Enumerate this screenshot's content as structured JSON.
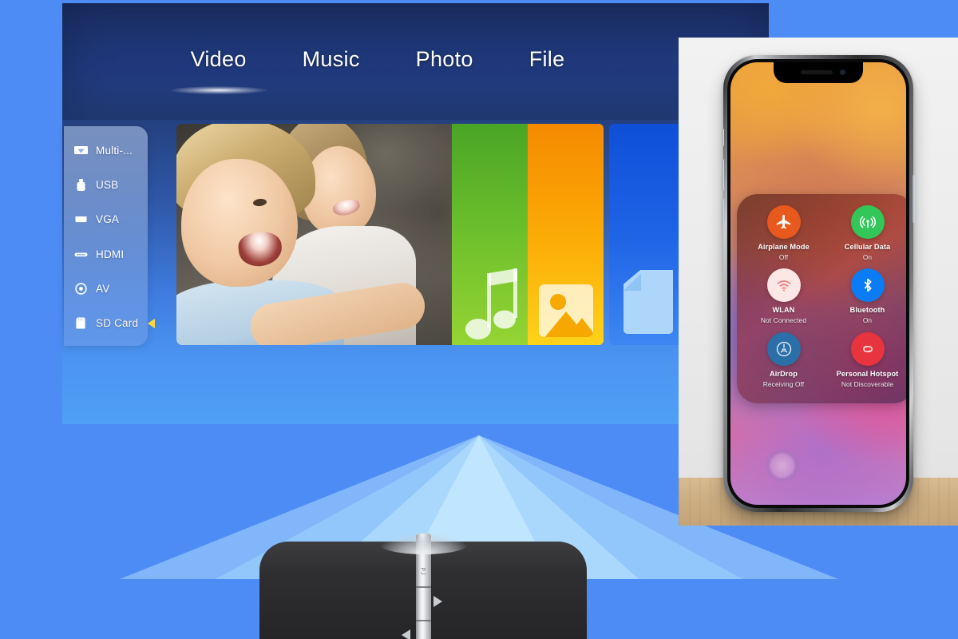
{
  "background": {
    "color": "#4d8cf5"
  },
  "projection": {
    "nav": {
      "tabs": [
        {
          "label": "Video",
          "active": true
        },
        {
          "label": "Music",
          "active": false
        },
        {
          "label": "Photo",
          "active": false
        },
        {
          "label": "File",
          "active": false
        }
      ]
    },
    "sidebar": {
      "items": [
        {
          "label": "Multi-...",
          "icon": "screen-cast-icon",
          "selected": false
        },
        {
          "label": "USB",
          "icon": "usb-drive-icon",
          "selected": false
        },
        {
          "label": "VGA",
          "icon": "vga-port-icon",
          "selected": false
        },
        {
          "label": "HDMI",
          "icon": "hdmi-port-icon",
          "selected": false
        },
        {
          "label": "AV",
          "icon": "av-jack-icon",
          "selected": false
        },
        {
          "label": "SD Card",
          "icon": "sd-card-icon",
          "selected": true,
          "marker_color": "#ffd93b"
        }
      ]
    },
    "tiles": [
      {
        "name": "video-thumbnail",
        "kind": "photo",
        "accent": "#2b2a28"
      },
      {
        "name": "music-tile",
        "kind": "music-note-icon",
        "accent": "#6cbf2b"
      },
      {
        "name": "photo-tile",
        "kind": "image-icon",
        "accent": "#fbaa06"
      },
      {
        "name": "file-tile",
        "kind": "document-icon",
        "accent": "#1f63e6"
      }
    ]
  },
  "device": {
    "name": "portable-projector",
    "body_color": "#2f2f31",
    "spine_color": "#e8eaec"
  },
  "phone": {
    "control_center": {
      "tiles": [
        {
          "title": "Airplane Mode",
          "status": "Off",
          "icon": "airplane-icon",
          "color": "#e8591d"
        },
        {
          "title": "Cellular Data",
          "status": "On",
          "icon": "cellular-antenna-icon",
          "color": "#33c759"
        },
        {
          "title": "WLAN",
          "status": "Not Connected",
          "icon": "wifi-icon",
          "color": "#fbe8e6"
        },
        {
          "title": "Bluetooth",
          "status": "On",
          "icon": "bluetooth-icon",
          "color": "#0a7cf5"
        },
        {
          "title": "AirDrop",
          "status": "Receiving Off",
          "icon": "airdrop-icon",
          "color": "#2b6fa8"
        },
        {
          "title": "Personal Hotspot",
          "status": "Not Discoverable",
          "icon": "hotspot-link-icon",
          "color": "#e8343f"
        }
      ]
    }
  }
}
